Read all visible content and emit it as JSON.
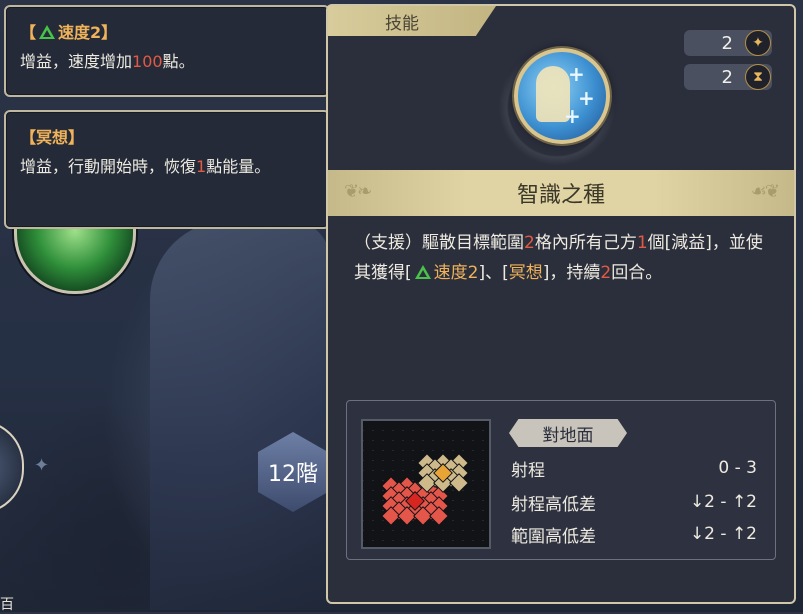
{
  "buff_tooltips": [
    {
      "title_open": "【",
      "title_name": "速度2",
      "title_close": "】",
      "body_prefix": "增益，速度增加",
      "body_value": "100",
      "body_suffix": "點。"
    },
    {
      "title": "【冥想】",
      "body_prefix": "增益，行動開始時，恢復",
      "body_value": "1",
      "body_suffix": "點能量。"
    }
  ],
  "background": {
    "floor_label": "12階",
    "bottom_text": "百"
  },
  "skill": {
    "tab_label": "技能",
    "cost": "2",
    "cost_icon": "energy-icon",
    "cooldown": "2",
    "cooldown_icon": "hourglass-icon",
    "name": "智識之種",
    "description": {
      "p1": "（支援）驅散目標範圍",
      "range_num": "2",
      "p2": "格內所有己方",
      "count_num": "1",
      "p3": "個[減益]，並使其獲得[",
      "buff1": "速度2",
      "p4": "]、[",
      "buff2": "冥想",
      "p5": "]，持續",
      "turns_num": "2",
      "p6": "回合。"
    },
    "target_type": "對地面",
    "stats": [
      {
        "label": "射程",
        "value": "0 - 3"
      },
      {
        "label": "射程高低差",
        "value": "↓2 - ↑2"
      },
      {
        "label": "範圍高低差",
        "value": "↓2 - ↑2"
      }
    ]
  },
  "colors": {
    "highlight_red": "#e25a43",
    "buff_gold": "#f0b35a",
    "buff_green": "#49c24a",
    "panel_bg": "#2b2f3c",
    "title_bar": "#e0d4a4"
  }
}
